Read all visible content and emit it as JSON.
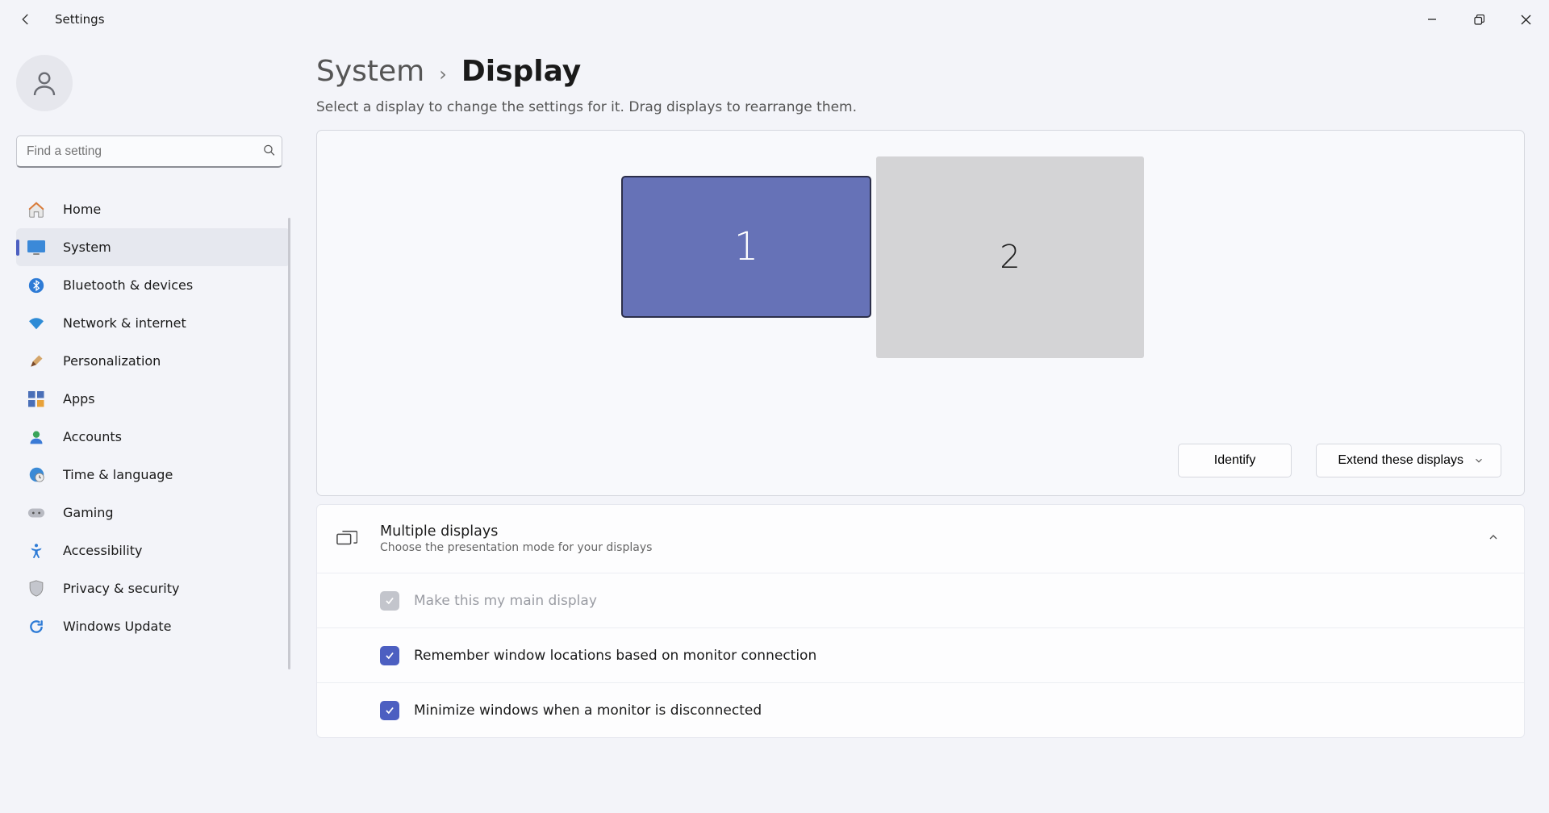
{
  "app_title": "Settings",
  "search": {
    "placeholder": "Find a setting"
  },
  "nav": {
    "items": [
      {
        "label": "Home"
      },
      {
        "label": "System"
      },
      {
        "label": "Bluetooth & devices"
      },
      {
        "label": "Network & internet"
      },
      {
        "label": "Personalization"
      },
      {
        "label": "Apps"
      },
      {
        "label": "Accounts"
      },
      {
        "label": "Time & language"
      },
      {
        "label": "Gaming"
      },
      {
        "label": "Accessibility"
      },
      {
        "label": "Privacy & security"
      },
      {
        "label": "Windows Update"
      }
    ]
  },
  "breadcrumb": {
    "parent": "System",
    "current": "Display"
  },
  "page_desc": "Select a display to change the settings for it. Drag displays to rearrange them.",
  "monitors": {
    "m1": "1",
    "m2": "2"
  },
  "buttons": {
    "identify": "Identify",
    "extend": "Extend these displays"
  },
  "multidisplay": {
    "title": "Multiple displays",
    "desc": "Choose the presentation mode for your displays",
    "opt_main": "Make this my main display",
    "opt_remember": "Remember window locations based on monitor connection",
    "opt_minimize": "Minimize windows when a monitor is disconnected"
  }
}
